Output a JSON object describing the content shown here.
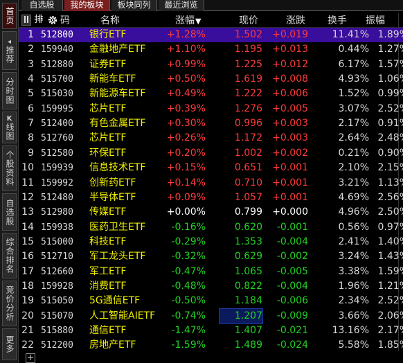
{
  "sidebar": {
    "tabs": [
      {
        "label": "首页"
      },
      {
        "label": "推荐",
        "glyph": "◂"
      },
      {
        "label": "分时图"
      },
      {
        "label": "线图",
        "glyph": "K"
      },
      {
        "label": "个股资料"
      },
      {
        "label": "自选股"
      },
      {
        "label": "综合排名"
      },
      {
        "label": "竞价分析"
      },
      {
        "label": "更多"
      }
    ]
  },
  "top_tabs": [
    {
      "label": "自选股"
    },
    {
      "label": "我的板块",
      "active": true
    },
    {
      "label": "板块同列"
    },
    {
      "label": "最近浏览"
    }
  ],
  "header": {
    "sort_btn_label": "排",
    "gear_icon": "gear-icon",
    "code_label": "码",
    "name_label": "名称",
    "pct_label": "涨幅",
    "pct_sort_icon": "▼",
    "price_label": "现价",
    "chg_label": "涨跌",
    "turnover_label": "换手",
    "amp_label": "振幅"
  },
  "rows": [
    {
      "idx": "1",
      "code": "512800",
      "name": "银行ETF",
      "pct": "+1.28%",
      "price": "1.502",
      "chg": "+0.019",
      "turn": "11.41%",
      "amp": "1.89%",
      "dir": "up"
    },
    {
      "idx": "2",
      "code": "159940",
      "name": "金融地产ETF",
      "pct": "+1.10%",
      "price": "1.195",
      "chg": "+0.013",
      "turn": "0.44%",
      "amp": "1.27%",
      "dir": "up"
    },
    {
      "idx": "3",
      "code": "512880",
      "name": "证券ETF",
      "pct": "+0.99%",
      "price": "1.225",
      "chg": "+0.012",
      "turn": "6.17%",
      "amp": "1.57%",
      "dir": "up"
    },
    {
      "idx": "4",
      "code": "515700",
      "name": "新能车ETF",
      "pct": "+0.50%",
      "price": "1.619",
      "chg": "+0.008",
      "turn": "4.93%",
      "amp": "1.06%",
      "dir": "up"
    },
    {
      "idx": "5",
      "code": "515030",
      "name": "新能源车ETF",
      "pct": "+0.49%",
      "price": "1.222",
      "chg": "+0.006",
      "turn": "1.52%",
      "amp": "0.99%",
      "dir": "up"
    },
    {
      "idx": "6",
      "code": "159995",
      "name": "芯片ETF",
      "pct": "+0.39%",
      "price": "1.276",
      "chg": "+0.005",
      "turn": "3.07%",
      "amp": "2.52%",
      "dir": "up"
    },
    {
      "idx": "7",
      "code": "512400",
      "name": "有色金属ETF",
      "pct": "+0.30%",
      "price": "0.996",
      "chg": "+0.003",
      "turn": "2.17%",
      "amp": "0.91%",
      "dir": "up"
    },
    {
      "idx": "8",
      "code": "512760",
      "name": "芯片ETF",
      "pct": "+0.26%",
      "price": "1.172",
      "chg": "+0.003",
      "turn": "2.64%",
      "amp": "2.48%",
      "dir": "up"
    },
    {
      "idx": "9",
      "code": "512580",
      "name": "环保ETF",
      "pct": "+0.20%",
      "price": "1.002",
      "chg": "+0.002",
      "turn": "0.21%",
      "amp": "0.90%",
      "dir": "up"
    },
    {
      "idx": "10",
      "code": "159939",
      "name": "信息技术ETF",
      "pct": "+0.15%",
      "price": "0.651",
      "chg": "+0.001",
      "turn": "2.10%",
      "amp": "2.15%",
      "dir": "up"
    },
    {
      "idx": "11",
      "code": "159992",
      "name": "创新药ETF",
      "pct": "+0.14%",
      "price": "0.710",
      "chg": "+0.001",
      "turn": "3.21%",
      "amp": "1.13%",
      "dir": "up"
    },
    {
      "idx": "12",
      "code": "512480",
      "name": "半导体ETF",
      "pct": "+0.09%",
      "price": "1.057",
      "chg": "+0.001",
      "turn": "4.69%",
      "amp": "2.56%",
      "dir": "up"
    },
    {
      "idx": "13",
      "code": "512980",
      "name": "传媒ETF",
      "pct": "+0.00%",
      "price": "0.799",
      "chg": "+0.000",
      "turn": "4.96%",
      "amp": "2.50%",
      "dir": "flat"
    },
    {
      "idx": "14",
      "code": "159938",
      "name": "医药卫生ETF",
      "pct": "-0.16%",
      "price": "0.620",
      "chg": "-0.001",
      "turn": "0.56%",
      "amp": "0.97%",
      "dir": "down"
    },
    {
      "idx": "15",
      "code": "515000",
      "name": "科技ETF",
      "pct": "-0.29%",
      "price": "1.353",
      "chg": "-0.004",
      "turn": "2.41%",
      "amp": "1.40%",
      "dir": "down"
    },
    {
      "idx": "16",
      "code": "512710",
      "name": "军工龙头ETF",
      "pct": "-0.32%",
      "price": "0.629",
      "chg": "-0.002",
      "turn": "3.24%",
      "amp": "1.43%",
      "dir": "down"
    },
    {
      "idx": "17",
      "code": "512660",
      "name": "军工ETF",
      "pct": "-0.47%",
      "price": "1.065",
      "chg": "-0.005",
      "turn": "3.38%",
      "amp": "1.59%",
      "dir": "down"
    },
    {
      "idx": "18",
      "code": "159928",
      "name": "消费ETF",
      "pct": "-0.48%",
      "price": "0.822",
      "chg": "-0.004",
      "turn": "1.96%",
      "amp": "1.21%",
      "dir": "down"
    },
    {
      "idx": "19",
      "code": "515050",
      "name": "5G通信ETF",
      "pct": "-0.50%",
      "price": "1.184",
      "chg": "-0.006",
      "turn": "2.34%",
      "amp": "2.52%",
      "dir": "down"
    },
    {
      "idx": "20",
      "code": "515070",
      "name": "人工智能AIETF",
      "pct": "-0.74%",
      "price": "1.207",
      "chg": "-0.009",
      "turn": "3.66%",
      "amp": "2.06%",
      "dir": "down",
      "price_box": true
    },
    {
      "idx": "21",
      "code": "515880",
      "name": "通信ETF",
      "pct": "-1.47%",
      "price": "1.407",
      "chg": "-0.021",
      "turn": "13.16%",
      "amp": "2.17%",
      "dir": "down"
    },
    {
      "idx": "22",
      "code": "512200",
      "name": "房地产ETF",
      "pct": "-1.59%",
      "price": "1.489",
      "chg": "-0.024",
      "turn": "5.58%",
      "amp": "1.85%",
      "dir": "down"
    }
  ],
  "footer": {
    "add_label": "+"
  },
  "colors": {
    "up": "#ff3b3b",
    "down": "#22d122",
    "flat": "#ffffff",
    "name": "#f0f000",
    "selected_row": "#3a0e9c",
    "active_tab": "#7a1f1f"
  }
}
